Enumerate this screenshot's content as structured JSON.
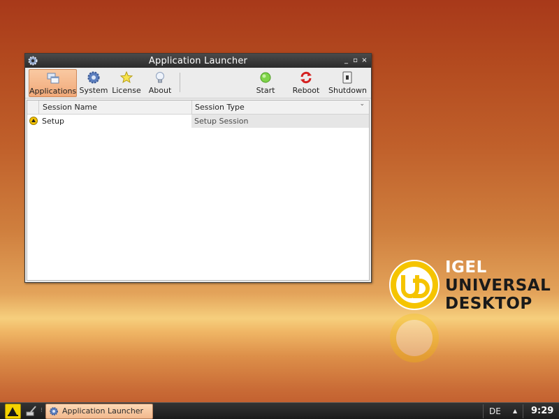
{
  "window": {
    "title": "Application Launcher",
    "controls": {
      "minimize": "_",
      "maximize": "▫",
      "close": "×"
    }
  },
  "toolbar": {
    "applications": "Applications",
    "system": "System",
    "license": "License",
    "about": "About",
    "start": "Start",
    "reboot": "Reboot",
    "shutdown": "Shutdown"
  },
  "table": {
    "columns": [
      "Session Name",
      "Session Type"
    ],
    "rows": [
      {
        "name": "Setup",
        "type": "Setup Session"
      }
    ]
  },
  "logo": {
    "line1": "IGEL",
    "line2": "UNIVERSAL",
    "line3": "DESKTOP"
  },
  "taskbar": {
    "task_label": "Application Launcher",
    "keyboard_layout": "DE",
    "clock": "9:29"
  },
  "colors": {
    "accent": "#f1a979",
    "titlebar": "#2c2c2c",
    "logo_yellow": "#f5c400"
  }
}
